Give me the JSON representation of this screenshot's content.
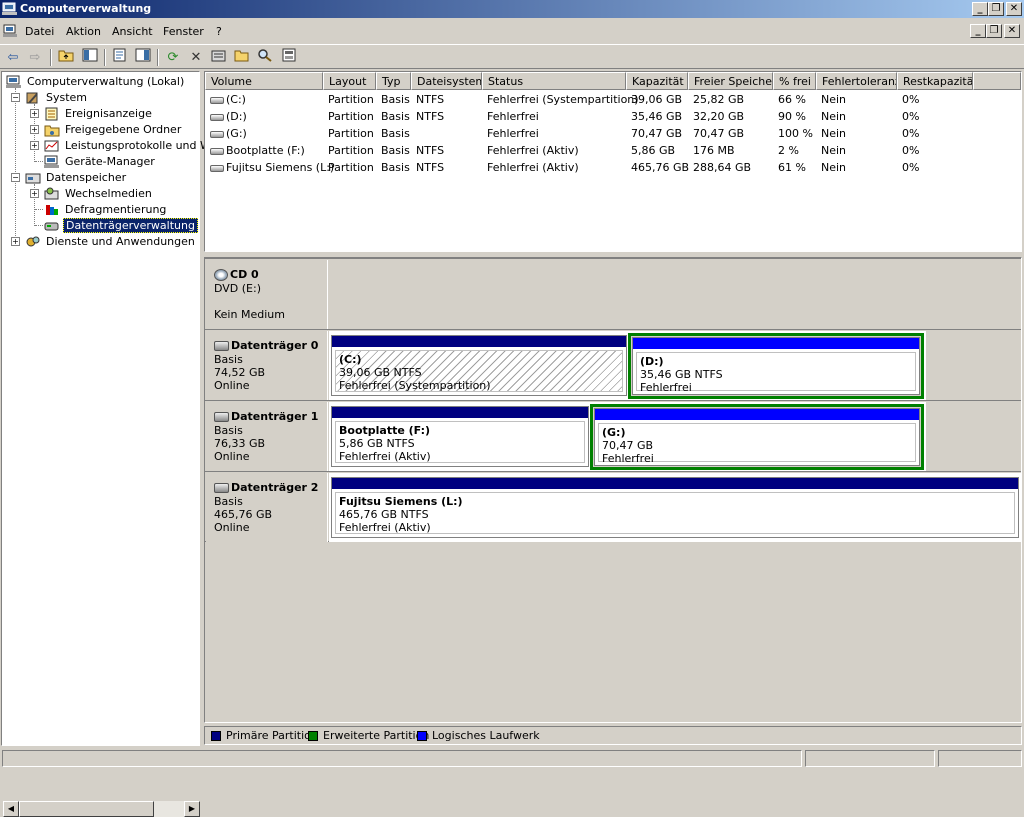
{
  "window": {
    "title": "Computerverwaltung"
  },
  "menu": {
    "items": [
      "Datei",
      "Aktion",
      "Ansicht",
      "Fenster",
      "?"
    ]
  },
  "toolbar": {
    "buttons": [
      "back-arrow-icon",
      "forward-arrow-icon",
      "up-folder-icon",
      "show-tree-icon",
      "properties-icon",
      "show-hide-icon",
      "refresh-icon",
      "delete-icon",
      "properties-2-icon",
      "open-folder-icon",
      "search-icon",
      "help-icon"
    ]
  },
  "tree": {
    "root": "Computerverwaltung (Lokal)",
    "system": "System",
    "ereignis": "Ereignisanzeige",
    "ordner": "Freigegebene Ordner",
    "leistung": "Leistungsprotokolle und War",
    "geraete": "Geräte-Manager",
    "datenspeicher": "Datenspeicher",
    "wechsel": "Wechselmedien",
    "defrag": "Defragmentierung",
    "dtv": "Datenträgerverwaltung",
    "dienste": "Dienste und Anwendungen"
  },
  "volume_table": {
    "headers": [
      "Volume",
      "Layout",
      "Typ",
      "Dateisystem",
      "Status",
      "Kapazität",
      "Freier Speicher",
      "% frei",
      "Fehlertoleranz",
      "Restkapazität"
    ],
    "rows": [
      [
        "(C:)",
        "Partition",
        "Basis",
        "NTFS",
        "Fehlerfrei (Systempartition)",
        "39,06 GB",
        "25,82 GB",
        "66 %",
        "Nein",
        "0%"
      ],
      [
        "(D:)",
        "Partition",
        "Basis",
        "NTFS",
        "Fehlerfrei",
        "35,46 GB",
        "32,20 GB",
        "90 %",
        "Nein",
        "0%"
      ],
      [
        "(G:)",
        "Partition",
        "Basis",
        "",
        "Fehlerfrei",
        "70,47 GB",
        "70,47 GB",
        "100 %",
        "Nein",
        "0%"
      ],
      [
        "Bootplatte (F:)",
        "Partition",
        "Basis",
        "NTFS",
        "Fehlerfrei (Aktiv)",
        "5,86 GB",
        "176 MB",
        "2 %",
        "Nein",
        "0%"
      ],
      [
        "Fujitsu Siemens (L:)",
        "Partition",
        "Basis",
        "NTFS",
        "Fehlerfrei (Aktiv)",
        "465,76 GB",
        "288,64 GB",
        "61 %",
        "Nein",
        "0%"
      ]
    ]
  },
  "disks": {
    "cd0": {
      "name": "CD 0",
      "type": "DVD (E:)",
      "medium": "Kein Medium"
    },
    "d0": {
      "name": "Datenträger 0",
      "type": "Basis",
      "size": "74,52 GB",
      "state": "Online",
      "p1": {
        "name": "(C:)",
        "size": "39,06 GB NTFS",
        "status": "Fehlerfrei (Systempartition)"
      },
      "p2": {
        "name": "(D:)",
        "size": "35,46 GB NTFS",
        "status": "Fehlerfrei"
      }
    },
    "d1": {
      "name": "Datenträger 1",
      "type": "Basis",
      "size": "76,33 GB",
      "state": "Online",
      "p1": {
        "name": "Bootplatte  (F:)",
        "size": "5,86 GB NTFS",
        "status": "Fehlerfrei (Aktiv)"
      },
      "p2": {
        "name": "(G:)",
        "size": "70,47 GB",
        "status": "Fehlerfrei"
      }
    },
    "d2": {
      "name": "Datenträger 2",
      "type": "Basis",
      "size": "465,76 GB",
      "state": "Online",
      "p1": {
        "name": "Fujitsu Siemens  (L:)",
        "size": "465,76 GB NTFS",
        "status": "Fehlerfrei (Aktiv)"
      }
    }
  },
  "legend": {
    "primary": "Primäre Partition",
    "extended": "Erweiterte Partition",
    "logical": "Logisches Laufwerk"
  },
  "colors": {
    "primary": "#000080",
    "extended": "#008000",
    "logical": "#0000ff",
    "title_start": "#0a246a",
    "title_end": "#a6caf0"
  }
}
